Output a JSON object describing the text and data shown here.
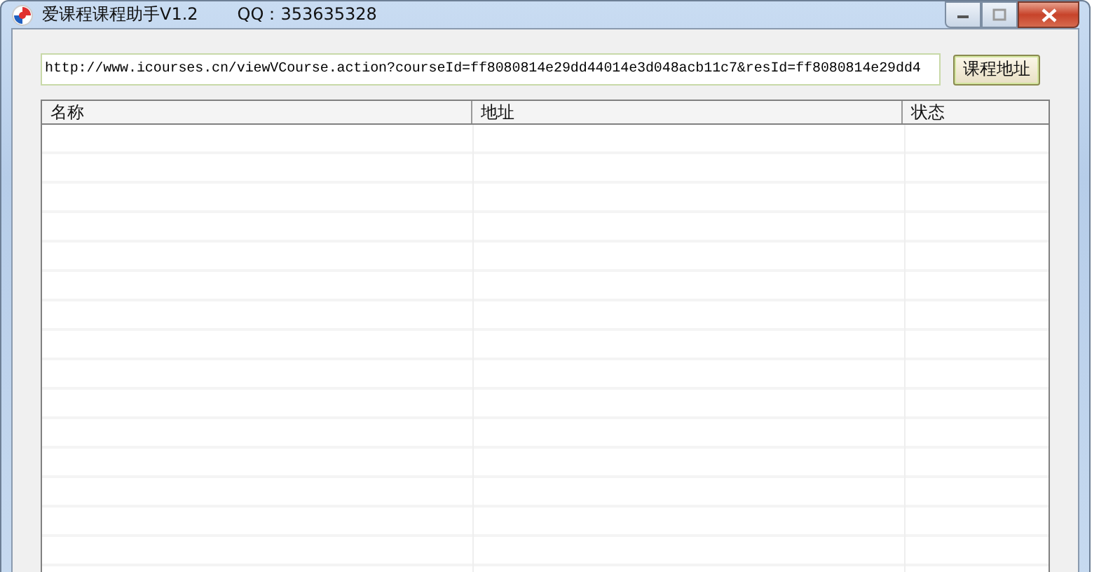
{
  "window": {
    "title": "爱课程课程助手V1.2",
    "subtitle": "QQ：353635328"
  },
  "url_field": {
    "value": "http://www.icourses.cn/viewVCourse.action?courseId=ff8080814e29dd44014e3d048acb11c7&resId=ff8080814e29dd4"
  },
  "button": {
    "label": "课程地址"
  },
  "table": {
    "columns": [
      "名称",
      "地址",
      "状态"
    ]
  }
}
